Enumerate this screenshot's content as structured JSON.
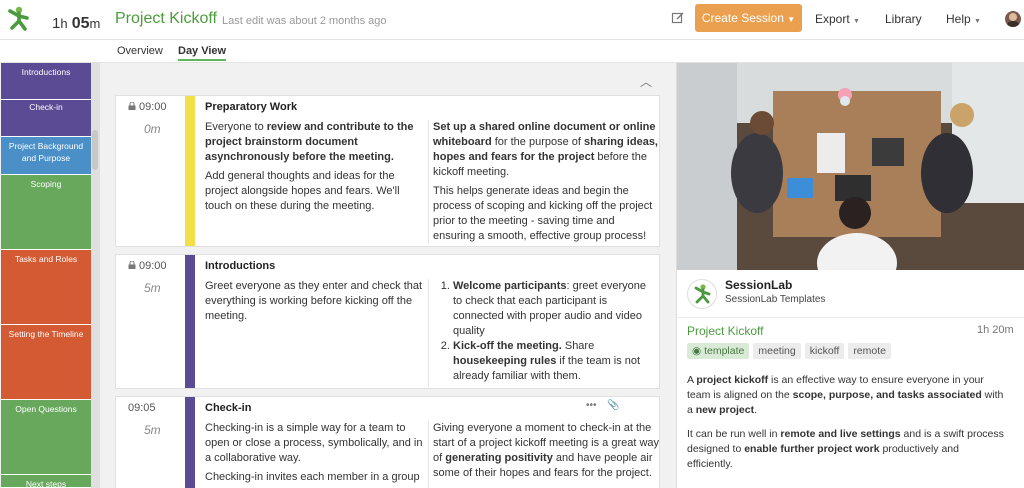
{
  "header": {
    "duration_h": "1",
    "duration_h_unit": "h",
    "duration_m": "05",
    "duration_m_unit": "m",
    "title": "Project Kickoff",
    "last_edit": "Last edit was about 2 months ago",
    "create_session": "Create Session",
    "nav": [
      "Export",
      "Library",
      "Help"
    ],
    "icons": {
      "edit": "edit-icon",
      "logo": "sessionlab-logo",
      "avatar": "user-avatar"
    }
  },
  "tabs": [
    "Overview",
    "Day View"
  ],
  "active_tab": "Day View",
  "sidebar": {
    "blocks": [
      {
        "label": "Introductions",
        "color": "#5b4a94"
      },
      {
        "label": "Check-in",
        "color": "#5b4a94"
      },
      {
        "label": "Project Background and Purpose",
        "color": "#4b8fc9"
      },
      {
        "label": "Scoping",
        "color": "#68a85d"
      },
      {
        "label": "Tasks and Roles",
        "color": "#d45a33"
      },
      {
        "label": "Setting the Timeline",
        "color": "#d45a33"
      },
      {
        "label": "Open Questions",
        "color": "#68a85d"
      },
      {
        "label": "Next steps",
        "color": "#68a85d"
      }
    ]
  },
  "cards": [
    {
      "time": "09:00",
      "locked": true,
      "duration": "0m",
      "color": "#f3df4a",
      "title": "Preparatory Work",
      "left_1": "Everyone to review and contribute to the project brainstorm document asynchronously before the meeting.",
      "left_2": "Add general thoughts and ideas for the project alongside hopes and fears. We'll touch on these during the meeting.",
      "right_1": "Set up a shared online document or online whiteboard for the purpose of sharing ideas, hopes and fears for the project before the kickoff meeting.",
      "right_2": "This helps generate ideas and begin the process of scoping and kicking off the project prior to the meeting - saving time and ensuring a smooth, effective group process!"
    },
    {
      "time": "09:00",
      "locked": true,
      "duration": "5m",
      "color": "#5b4a94",
      "title": "Introductions",
      "left_1": "Greet everyone as they enter and check that everything is working before kicking off the meeting.",
      "right_items": [
        "Welcome participants: greet everyone to check that each participant is connected with proper audio and video quality",
        "Kick-off the meeting. Share housekeeping rules if the team is not already familiar with them."
      ]
    },
    {
      "time": "09:05",
      "locked": false,
      "duration": "5m",
      "color": "#5b4a94",
      "title": "Check-in",
      "left_1": "Checking-in is a simple way for a team to open or close a process, symbolically, and in a collaborative way.",
      "left_2": "Checking-in invites each member in a group",
      "right_1": "Giving everyone a moment to check-in at the start of a project kickoff meeting is a great way of generating positivity and have people air some of their hopes and fears for the project."
    }
  ],
  "right_panel": {
    "org_name": "SessionLab",
    "org_sub": "SessionLab Templates",
    "title": "Project Kickoff",
    "duration": "1h 20m",
    "tags": [
      "template",
      "meeting",
      "kickoff",
      "remote"
    ],
    "desc_1": "A project kickoff is an effective way to ensure everyone in your team is aligned on the scope, purpose, and tasks associated with a new project.",
    "desc_2": "It can be run well in remote and live settings and is a swift process designed to enable further project work productively and efficiently."
  }
}
